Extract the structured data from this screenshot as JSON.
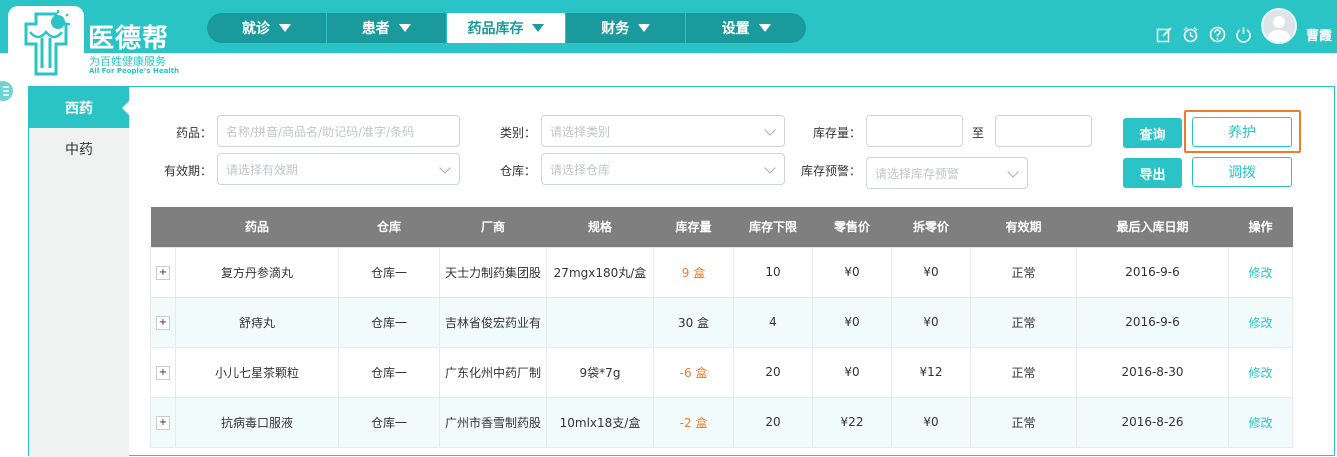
{
  "brand": {
    "name": "医德帮",
    "subtitle": "为百姓健康服务",
    "tagline": "All For People’s Health"
  },
  "nav": {
    "items": [
      {
        "label": "就诊"
      },
      {
        "label": "患者"
      },
      {
        "label": "药品库存"
      },
      {
        "label": "财务"
      },
      {
        "label": "设置"
      }
    ],
    "active_index": 2
  },
  "user": {
    "name": "曹霞"
  },
  "header_icons": [
    "edit-icon",
    "timer-icon",
    "help-icon",
    "power-icon"
  ],
  "sidebar": {
    "items": [
      {
        "label": "西药"
      },
      {
        "label": "中药"
      }
    ]
  },
  "filters": {
    "drug_label": "药品：",
    "drug_placeholder": "名称/拼音/商品名/助记码/准字/条码",
    "category_label": "类别：",
    "category_placeholder": "请选择类别",
    "stock_label": "库存量：",
    "stock_to_label": "至",
    "expiry_label": "有效期：",
    "expiry_placeholder": "请选择有效期",
    "warehouse_label": "仓库：",
    "warehouse_placeholder": "请选择仓库",
    "stock_alert_label": "库存预警：",
    "stock_alert_placeholder": "请选择库存预警"
  },
  "buttons": {
    "query": "查询",
    "export": "导出",
    "maintain": "养护",
    "transfer": "调拨"
  },
  "table": {
    "headers": [
      "",
      "药品",
      "仓库",
      "厂商",
      "规格",
      "库存量",
      "库存下限",
      "零售价",
      "拆零价",
      "有效期",
      "最后入库日期",
      "操作"
    ],
    "expand_symbol": "+",
    "rows": [
      {
        "drug": "复方丹参滴丸",
        "warehouse": "仓库一",
        "maker": "天士力制药集团股",
        "spec": "27mgx180丸/盒",
        "stock": "9 盒",
        "min": "10",
        "retail": "¥0",
        "split": "¥0",
        "expiry": "正常",
        "last_in": "2016-9-6",
        "action": "修改"
      },
      {
        "drug": "舒痔丸",
        "warehouse": "仓库一",
        "maker": "吉林省俊宏药业有",
        "spec": "",
        "stock": "30 盒",
        "min": "4",
        "retail": "¥0",
        "split": "¥0",
        "expiry": "正常",
        "last_in": "2016-9-6",
        "action": "修改"
      },
      {
        "drug": "小儿七星茶颗粒",
        "warehouse": "仓库一",
        "maker": "广东化州中药厂制",
        "spec": "9袋*7g",
        "stock": "-6 盒",
        "min": "20",
        "retail": "¥0",
        "split": "¥12",
        "expiry": "正常",
        "last_in": "2016-8-30",
        "action": "修改"
      },
      {
        "drug": "抗病毒口服液",
        "warehouse": "仓库一",
        "maker": "广州市香雪制药股",
        "spec": "10mlx18支/盒",
        "stock": "-2 盒",
        "min": "20",
        "retail": "¥22",
        "split": "¥0",
        "expiry": "正常",
        "last_in": "2016-8-26",
        "action": "修改"
      }
    ]
  },
  "colors": {
    "primary": "#2bc4c6",
    "nav_dark": "#1a9a9c",
    "warning": "#f07b2c",
    "table_header": "#7f7f7f"
  }
}
